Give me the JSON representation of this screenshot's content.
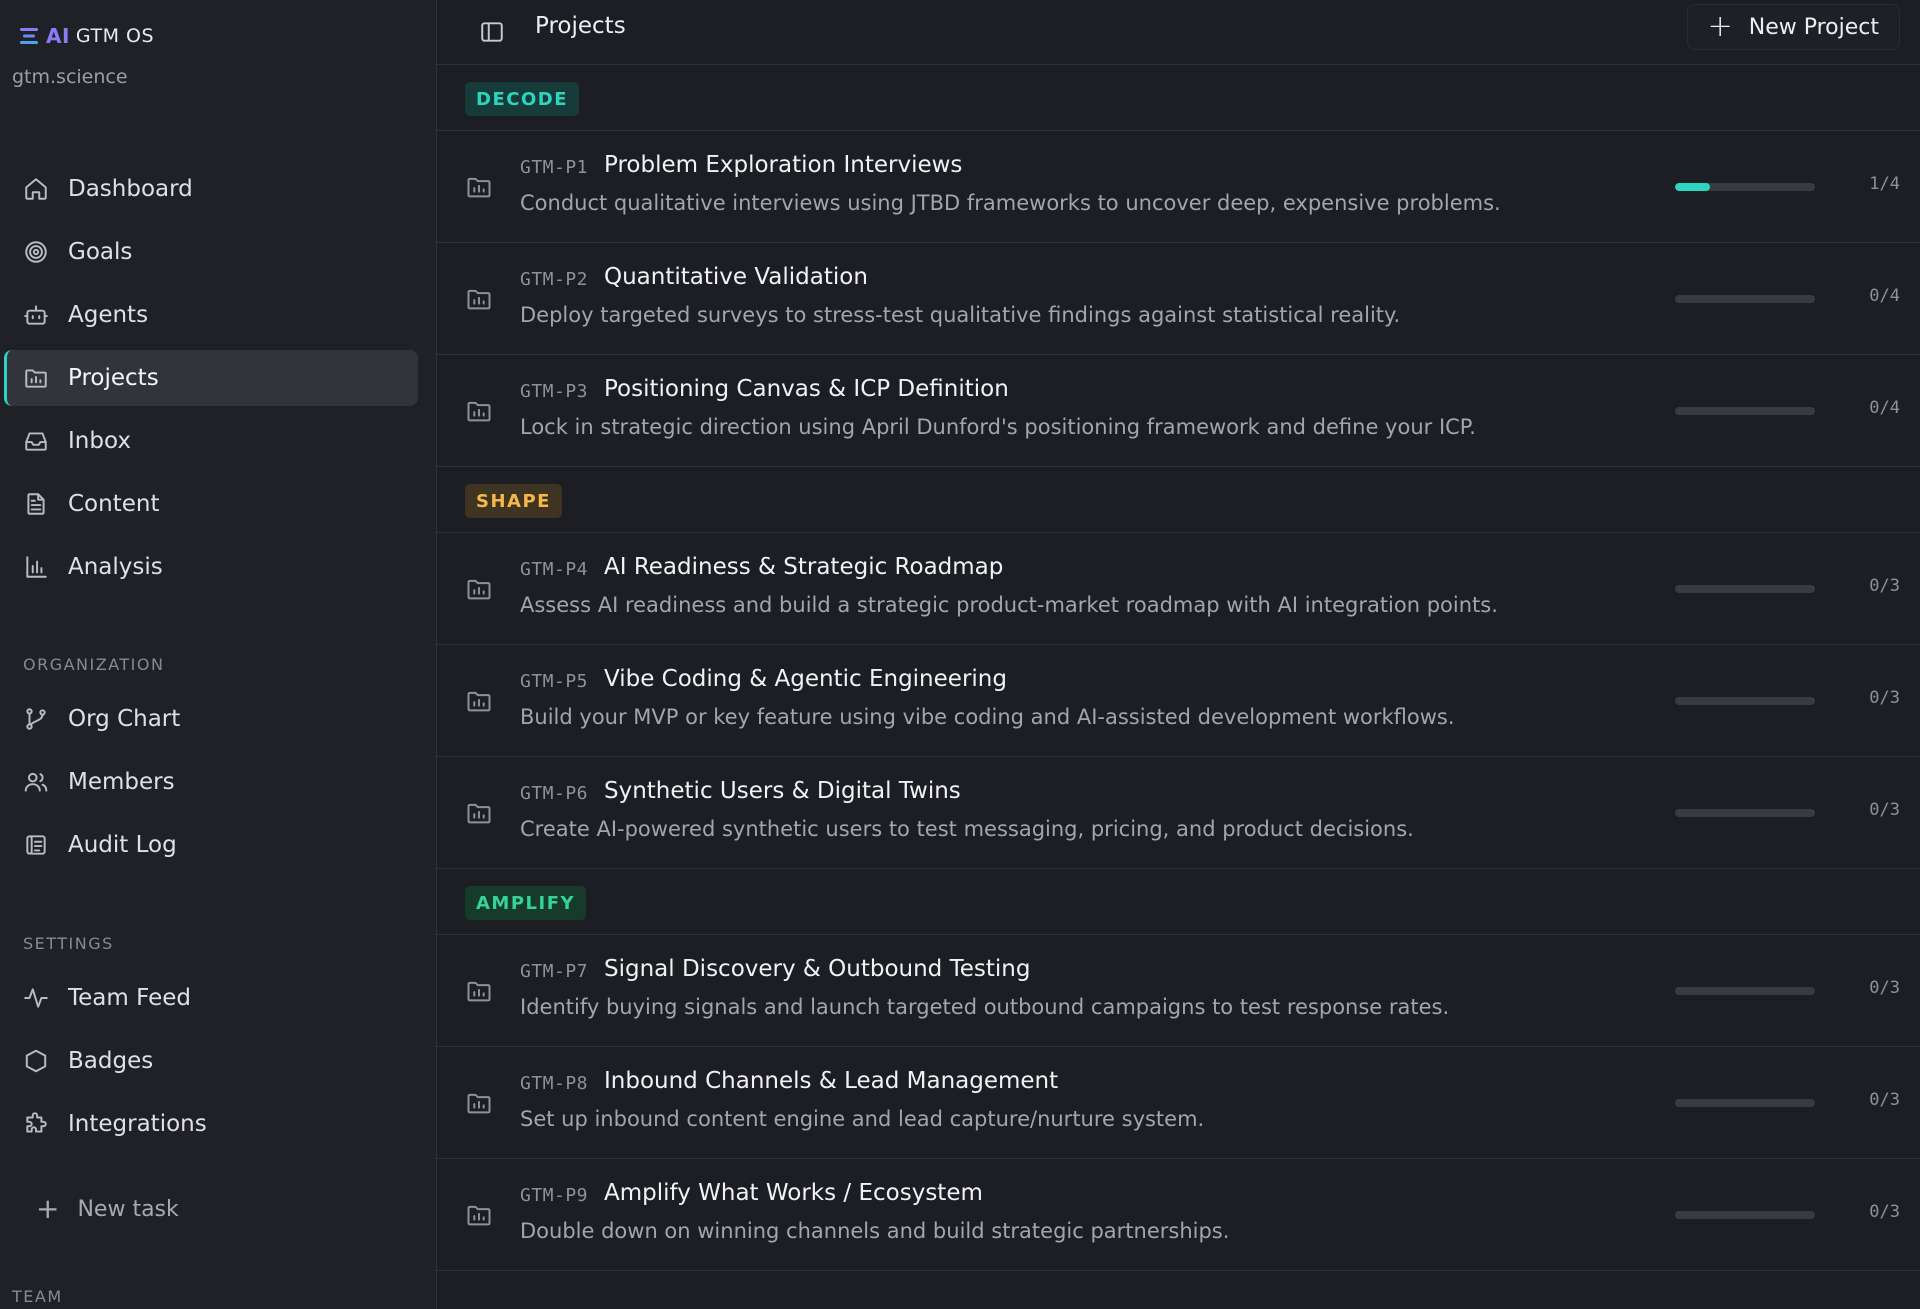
{
  "brand": {
    "ai": "AI",
    "name": "GTM OS",
    "domain": "gtm.science"
  },
  "sidebar": {
    "main_items": [
      {
        "label": "Dashboard",
        "icon": "home-icon"
      },
      {
        "label": "Goals",
        "icon": "target-icon"
      },
      {
        "label": "Agents",
        "icon": "bot-icon"
      },
      {
        "label": "Projects",
        "icon": "folder-chart-icon",
        "active": true
      },
      {
        "label": "Inbox",
        "icon": "inbox-icon"
      },
      {
        "label": "Content",
        "icon": "document-icon"
      },
      {
        "label": "Analysis",
        "icon": "bar-chart-icon"
      }
    ],
    "organization_label": "ORGANIZATION",
    "organization_items": [
      {
        "label": "Org Chart",
        "icon": "git-branch-icon"
      },
      {
        "label": "Members",
        "icon": "users-icon"
      },
      {
        "label": "Audit Log",
        "icon": "scroll-icon"
      }
    ],
    "settings_label": "SETTINGS",
    "settings_items": [
      {
        "label": "Team Feed",
        "icon": "activity-icon"
      },
      {
        "label": "Badges",
        "icon": "hexagon-icon"
      },
      {
        "label": "Integrations",
        "icon": "puzzle-icon"
      }
    ],
    "new_task_label": "New task",
    "team_label": "TEAM"
  },
  "header": {
    "title": "Projects",
    "new_project_label": "New Project"
  },
  "groups": [
    {
      "tag": "DECODE",
      "projects": [
        {
          "code": "GTM-P1",
          "title": "Problem Exploration Interviews",
          "description": "Conduct qualitative interviews using JTBD frameworks to uncover deep, expensive problems.",
          "done": 1,
          "total": 4,
          "count": "1/4"
        },
        {
          "code": "GTM-P2",
          "title": "Quantitative Validation",
          "description": "Deploy targeted surveys to stress-test qualitative findings against statistical reality.",
          "done": 0,
          "total": 4,
          "count": "0/4"
        },
        {
          "code": "GTM-P3",
          "title": "Positioning Canvas & ICP Definition",
          "description": "Lock in strategic direction using April Dunford's positioning framework and define your ICP.",
          "done": 0,
          "total": 4,
          "count": "0/4"
        }
      ]
    },
    {
      "tag": "SHAPE",
      "projects": [
        {
          "code": "GTM-P4",
          "title": "AI Readiness & Strategic Roadmap",
          "description": "Assess AI readiness and build a strategic product-market roadmap with AI integration points.",
          "done": 0,
          "total": 3,
          "count": "0/3"
        },
        {
          "code": "GTM-P5",
          "title": "Vibe Coding & Agentic Engineering",
          "description": "Build your MVP or key feature using vibe coding and AI-assisted development workflows.",
          "done": 0,
          "total": 3,
          "count": "0/3"
        },
        {
          "code": "GTM-P6",
          "title": "Synthetic Users & Digital Twins",
          "description": "Create AI-powered synthetic users to test messaging, pricing, and product decisions.",
          "done": 0,
          "total": 3,
          "count": "0/3"
        }
      ]
    },
    {
      "tag": "AMPLIFY",
      "projects": [
        {
          "code": "GTM-P7",
          "title": "Signal Discovery & Outbound Testing",
          "description": "Identify buying signals and launch targeted outbound campaigns to test response rates.",
          "done": 0,
          "total": 3,
          "count": "0/3"
        },
        {
          "code": "GTM-P8",
          "title": "Inbound Channels & Lead Management",
          "description": "Set up inbound content engine and lead capture/nurture system.",
          "done": 0,
          "total": 3,
          "count": "0/3"
        },
        {
          "code": "GTM-P9",
          "title": "Amplify What Works / Ecosystem",
          "description": "Double down on winning channels and build strategic partnerships.",
          "done": 0,
          "total": 3,
          "count": "0/3"
        }
      ]
    }
  ],
  "colors": {
    "accent": "#2dd4bf",
    "decode": "#2dd4bf",
    "shape": "#f5b84a",
    "amplify": "#34d399",
    "background": "#1d1e23"
  }
}
